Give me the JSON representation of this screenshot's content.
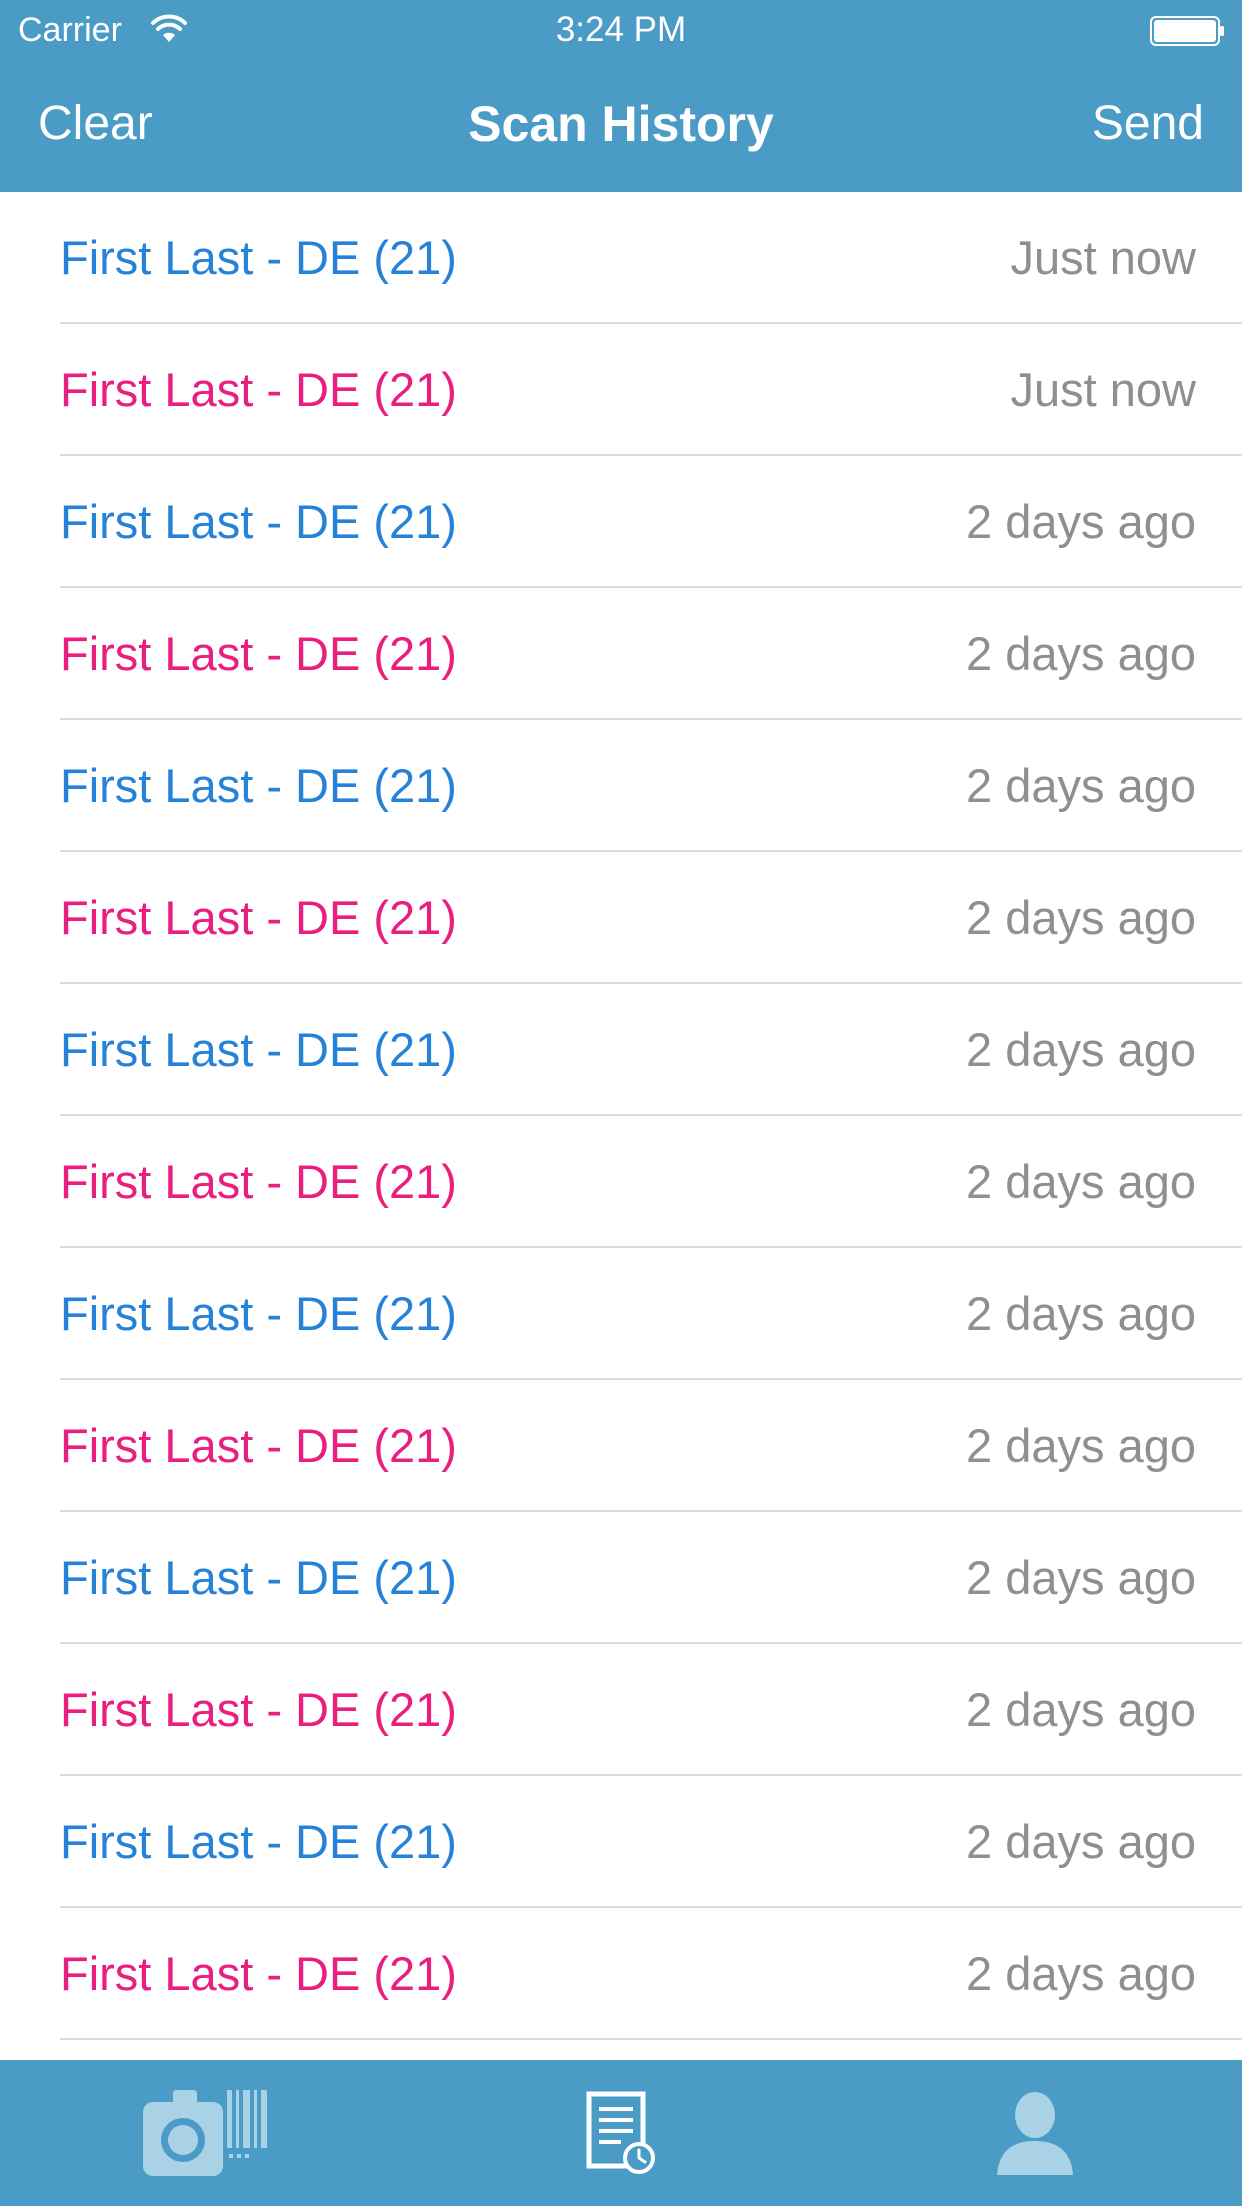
{
  "status_bar": {
    "carrier": "Carrier",
    "time": "3:24 PM",
    "wifi_icon": "wifi-icon",
    "battery_icon": "battery-icon"
  },
  "nav": {
    "left_label": "Clear",
    "title": "Scan History",
    "right_label": "Send"
  },
  "colors": {
    "bar_background": "#4a9cc7",
    "entry_blue": "#2682d9",
    "entry_pink": "#e91e7f",
    "time_gray": "#8e8e93",
    "tab_icon": "#a9d2e6"
  },
  "history": [
    {
      "name": "First Last - DE (21)",
      "time": "Just now",
      "color": "#2682d9"
    },
    {
      "name": "First Last - DE (21)",
      "time": "Just now",
      "color": "#e91e7f"
    },
    {
      "name": "First Last - DE (21)",
      "time": "2 days ago",
      "color": "#2682d9"
    },
    {
      "name": "First Last - DE (21)",
      "time": "2 days ago",
      "color": "#e91e7f"
    },
    {
      "name": "First Last - DE (21)",
      "time": "2 days ago",
      "color": "#2682d9"
    },
    {
      "name": "First Last - DE (21)",
      "time": "2 days ago",
      "color": "#e91e7f"
    },
    {
      "name": "First Last - DE (21)",
      "time": "2 days ago",
      "color": "#2682d9"
    },
    {
      "name": "First Last - DE (21)",
      "time": "2 days ago",
      "color": "#e91e7f"
    },
    {
      "name": "First Last - DE (21)",
      "time": "2 days ago",
      "color": "#2682d9"
    },
    {
      "name": "First Last - DE (21)",
      "time": "2 days ago",
      "color": "#e91e7f"
    },
    {
      "name": "First Last - DE (21)",
      "time": "2 days ago",
      "color": "#2682d9"
    },
    {
      "name": "First Last - DE (21)",
      "time": "2 days ago",
      "color": "#e91e7f"
    },
    {
      "name": "First Last - DE (21)",
      "time": "2 days ago",
      "color": "#2682d9"
    },
    {
      "name": "First Last - DE (21)",
      "time": "2 days ago",
      "color": "#e91e7f"
    }
  ],
  "tab_bar": {
    "tabs": [
      {
        "icon": "camera-barcode-icon",
        "selected": false
      },
      {
        "icon": "history-document-icon",
        "selected": true
      },
      {
        "icon": "profile-icon",
        "selected": false
      }
    ]
  }
}
